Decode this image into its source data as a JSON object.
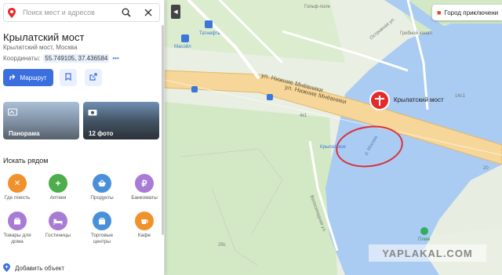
{
  "search": {
    "placeholder": "Поиск мест и адресов"
  },
  "place": {
    "title": "Крылатский мост",
    "subtitle": "Крылатский мост, Москва",
    "coords_label": "Координаты:",
    "coords_value": "55.749105, 37.436584",
    "coords_more": "•••"
  },
  "actions": {
    "route_label": "Маршрут"
  },
  "photos": [
    {
      "label": "Панорама"
    },
    {
      "label": "12 фото"
    }
  ],
  "nearby": {
    "title": "Искать рядом",
    "categories": [
      {
        "label": "Где поесть",
        "color": "#f0922c"
      },
      {
        "label": "Аптеки",
        "color": "#4cae4c"
      },
      {
        "label": "Продукты",
        "color": "#4a90d9"
      },
      {
        "label": "Банкоматы",
        "color": "#a77bd6"
      },
      {
        "label": "Товары для дома",
        "color": "#a77bd6"
      },
      {
        "label": "Гостиницы",
        "color": "#a77bd6"
      },
      {
        "label": "Торговые центры",
        "color": "#4a90d9"
      },
      {
        "label": "Кафе",
        "color": "#f0922c"
      }
    ]
  },
  "footer": {
    "add_object": "Добавить объект"
  },
  "map": {
    "city_button": "Город приключени",
    "marker_label": "Крылатский мост",
    "street_1": "ул. Нижние Мнёвники",
    "street_2": "ул. Нижние Мнёвники",
    "river_label": "р. Москва",
    "poi_gym": "Гольф-поле",
    "poi_tatneft": "Татнефть",
    "poi_masoil": "Масойл",
    "poi_grebnoy": "Гребной канал",
    "poi_krylatskoe": "Крылатское",
    "poi_plyazh": "Пляж",
    "house_1": "14с1",
    "house_2": "4к1",
    "house_3": "20",
    "house_4": "2бс",
    "street_ostrov": "Островная ул.",
    "street_velo": "Велосипедная ул."
  },
  "watermark": "YAPLAKAL.COM",
  "colors": {
    "accent": "#3b6fe0",
    "marker": "#e32b2b",
    "water": "#aacbf2",
    "park": "#cfe8c4",
    "road": "#f7d699",
    "annotation": "#d9303a"
  }
}
